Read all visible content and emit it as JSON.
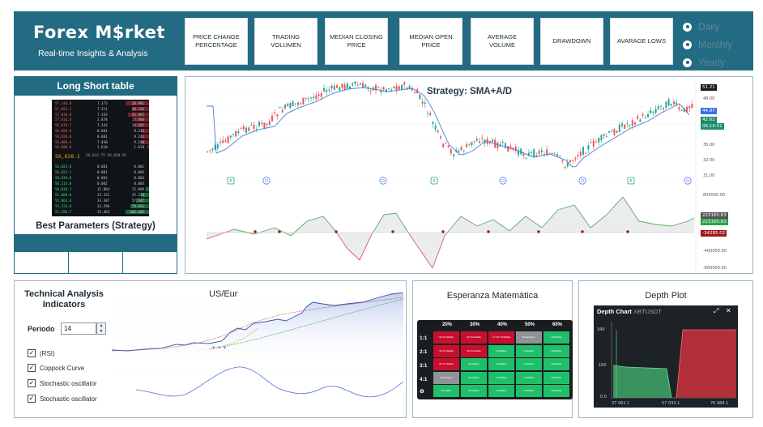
{
  "header": {
    "title": "Forex M$rket",
    "subtitle": "Real-time Insights & Analysis",
    "metrics": [
      "PRICE CHANGE PERCENTAGE",
      "TRADING VOLUMEN",
      "MEDIAN CLOSING PRICE",
      "MEDIAN OPEN PRICE",
      "AVERAGE VOLUME",
      "DRAWDOWN",
      "AVARAGE LOWS"
    ],
    "period_options": [
      "Daily",
      "Monthly",
      "Yearly"
    ]
  },
  "long_short": {
    "title": "Long Short table",
    "asks": [
      {
        "price": "57,146.8",
        "amount": "7.373",
        "total": "28.981"
      },
      {
        "price": "57,093.2",
        "amount": "7.311",
        "total": "20.716"
      },
      {
        "price": "57,018.8",
        "amount": "7.343",
        "total": "25.967"
      },
      {
        "price": "57,016.8",
        "amount": "2.878",
        "total": "17.566"
      },
      {
        "price": "56,879.7",
        "amount": "7.343",
        "total": "16.565"
      },
      {
        "price": "56,859.8",
        "amount": "0.001",
        "total": "9.243"
      },
      {
        "price": "56,820.0",
        "amount": "0.001",
        "total": "9.241"
      },
      {
        "price": "56,809.4",
        "amount": "7.430",
        "total": "9.240"
      },
      {
        "price": "56,808.8",
        "amount": "1.610",
        "total": "1.610"
      }
    ],
    "mid_price": "56,028.1",
    "mid_info": "56,033.75 56,030.01",
    "bids": [
      {
        "price": "56,825.6",
        "amount": "0.001",
        "total": "0.001"
      },
      {
        "price": "56,821.1",
        "amount": "0.001",
        "total": "0.003"
      },
      {
        "price": "56,810.0",
        "amount": "0.001",
        "total": "0.003"
      },
      {
        "price": "56,114.0",
        "amount": "0.002",
        "total": "0.005"
      },
      {
        "price": "56,038.1",
        "amount": "12.884",
        "total": "12.889"
      },
      {
        "price": "55,880.0",
        "amount": "33.331",
        "total": "35.220"
      },
      {
        "price": "55,863.4",
        "amount": "33.307",
        "total": "57.547"
      },
      {
        "price": "55,524.0",
        "amount": "33.296",
        "total": "79.941"
      },
      {
        "price": "55,280.7",
        "amount": "33.463",
        "total": "102.403"
      }
    ],
    "best_params_title": "Best Parameters (Strategy)"
  },
  "strategy": {
    "title": "Strategy: SMA+A/D",
    "price_axis": [
      "51.21",
      "48.00",
      "44.97",
      "42.62",
      "06:14:51",
      "35.00",
      "32.00",
      "31.00"
    ],
    "marker_letters": [
      "E",
      "D",
      "D",
      "E",
      "D",
      "D",
      "E",
      "D",
      "E"
    ],
    "ad_axis": [
      "800000.00",
      "223165.63",
      "223165.63",
      "-34285.02",
      "-400000.00",
      "-800000.00"
    ],
    "colors": {
      "up": "#26a69a",
      "down": "#ef5350",
      "sma": "#4a7fd4"
    }
  },
  "technical": {
    "title": "Technical Analysis Indicators",
    "chart_title": "US/Eur",
    "period_label": "Periodo",
    "period_value": "14",
    "indicators": [
      "(RSI)",
      "Coppock  Curve",
      "Stochastic oscillator",
      "Stochastic oscillator"
    ]
  },
  "esperanza": {
    "title": "Esperanza Matemática",
    "columns": [
      "20%",
      "30%",
      "40%",
      "50%",
      "60%"
    ],
    "rows": [
      "1:1",
      "2:1",
      "3:1",
      "4:1"
    ],
    "cells": [
      [
        "Sin Profitable",
        "Sin Profitable",
        "1:1 Sin Profitable",
        "Break Even",
        "Profitable"
      ],
      [
        "Sin Profitable",
        "Sin Profitable",
        "Profitable",
        "Profitable",
        "Profitable"
      ],
      [
        "Sin Profitable",
        "Profitable",
        "Profitable",
        "Profitable",
        "Profitable"
      ],
      [
        "Break Even",
        "Profitable",
        "Profitable",
        "Profitable",
        "Profitable"
      ],
      [
        "Profitable",
        "Profitable",
        "Profitable",
        "Profitable",
        "Profitable"
      ]
    ]
  },
  "depth": {
    "title": "Depth Plot",
    "chart_title": "Depth Chart",
    "pair": "XBTUSDT",
    "y_ticks": [
      "340",
      "160",
      "0.0"
    ],
    "x_ticks": [
      "37 062.1",
      "57 033.1",
      "76 984.1"
    ]
  }
}
